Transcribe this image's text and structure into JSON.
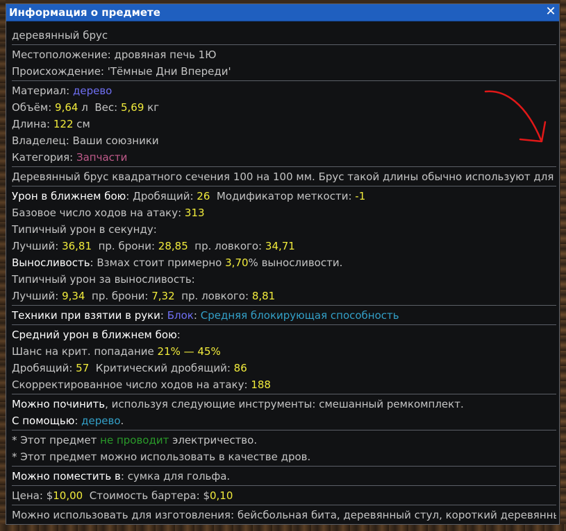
{
  "window": {
    "title": "Информация о предмете"
  },
  "item": {
    "name": "деревянный брус",
    "location_label": "Местоположение:",
    "location_value": "дровяная печь 1Ю",
    "origin_label": "Происхождение:",
    "origin_value": "'Тёмные Дни Впереди'"
  },
  "props": {
    "material_label": "Материал:",
    "material_value": "дерево",
    "volume_label": "Объём:",
    "volume_value": "9,64",
    "volume_unit": " л",
    "weight_label": "Вес:",
    "weight_value": "5,69",
    "weight_unit": " кг",
    "length_label": "Длина:",
    "length_value": "122",
    "length_unit": " см",
    "owner_label": "Владелец:",
    "owner_value": "Ваши союзники",
    "category_label": "Категория:",
    "category_value": "Запчасти"
  },
  "description": "Деревянный брус квадратного сечения 100 на 100 мм.  Брус такой длины обычно используют для",
  "melee": {
    "header": "Урон в ближнем бою",
    "bash_label": " Дробящий:",
    "bash_value": "26",
    "accuracy_label": "Модификатор меткости:",
    "accuracy_value": "-1",
    "base_moves_label": "Базовое число ходов на атаку:",
    "base_moves_value": "313",
    "dps_header": "Типичный урон в секунду:",
    "best_label": "Лучший:",
    "best_value": "36,81",
    "armor_label": "пр. брони:",
    "armor_value": "28,85",
    "agile_label": "пр. ловкого:",
    "agile_value": "34,71",
    "stamina_label": "Выносливость",
    "stamina_text_pre": "Взмах стоит примерно",
    "stamina_value": "3,70",
    "stamina_text_post": "% выносливости.",
    "stamina_dmg_header": "Типичный урон за выносливость:",
    "s_best_label": "Лучший:",
    "s_best_value": "9,34",
    "s_armor_label": "пр. брони:",
    "s_armor_value": "7,32",
    "s_agile_label": "пр. ловкого:",
    "s_agile_value": "8,81"
  },
  "techniques": {
    "label": "Техники при взятии в руки",
    "block_label": "Блок",
    "block_desc": "Средняя блокирующая способность"
  },
  "avg_melee": {
    "header": "Средний урон в ближнем бою",
    "crit_label": "Шанс на крит. попадание",
    "crit_value": "21% — 45%",
    "bash_label": "Дробящий:",
    "bash_value": "57",
    "crit_bash_label": "Критический дробящий:",
    "crit_bash_value": "86",
    "adj_moves_label": "Скорректированное число ходов на атаку:",
    "adj_moves_value": "188"
  },
  "repair": {
    "label": "Можно починить",
    "text": ", используя следующие инструменты: смешанный ремкомплект.",
    "with_label": "С помощью",
    "with_value": "дерево"
  },
  "notes": {
    "n1_pre": "* Этот предмет ",
    "n1_value": "не проводит",
    "n1_post": " электричество.",
    "n2": "* Этот предмет можно использовать в качестве дров."
  },
  "container": {
    "label": "Можно поместить в",
    "value": "сумка для гольфа."
  },
  "price": {
    "label": "Цена: $",
    "value": "10,00",
    "barter_label": "Стоимость бартера: $",
    "barter_value": "0,10"
  },
  "craft": {
    "label": "Можно использовать для изготовления:",
    "items": "бейсбольная бита, деревянный стул, короткий деревянный"
  },
  "colors": {
    "titlebar": "#1f5fbf",
    "highlight_yellow": "#f2ec3c",
    "material_blue": "#6f6ff2",
    "category_pink": "#c05a8a",
    "technique_cyan": "#33a0c8",
    "not_conductive_green": "#2a9a2a",
    "annotation_arrow": "#e01818"
  }
}
